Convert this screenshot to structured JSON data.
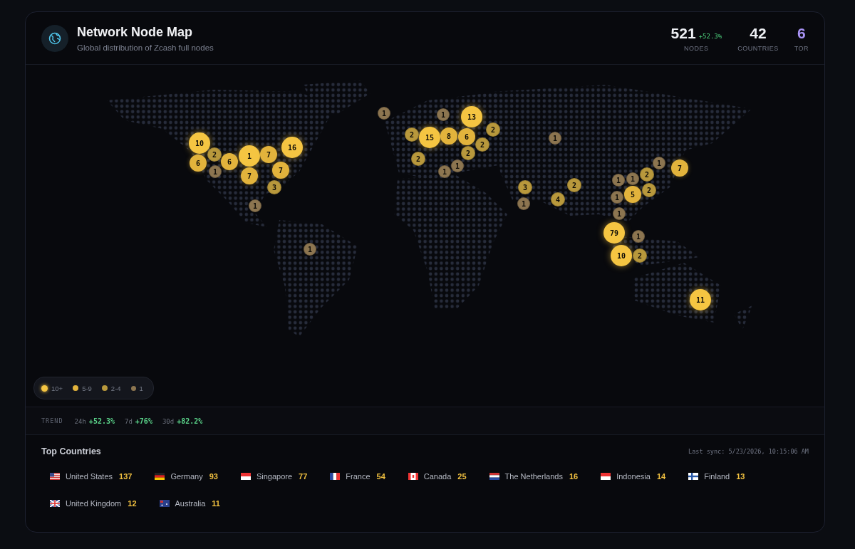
{
  "header": {
    "title": "Network Node Map",
    "subtitle": "Global distribution of Zcash full nodes"
  },
  "stats": [
    {
      "value": "521",
      "change": "+52.3%",
      "label": "NODES",
      "kind": "plain"
    },
    {
      "value": "42",
      "label": "COUNTRIES",
      "kind": "plain"
    },
    {
      "value": "6",
      "label": "TOR",
      "kind": "tor"
    }
  ],
  "map": {
    "bubbles": [
      {
        "count": "10",
        "kind": "large"
      },
      {
        "count": "6",
        "kind": "medium"
      },
      {
        "count": "2",
        "kind": "small"
      },
      {
        "count": "6",
        "kind": "medium"
      },
      {
        "count": "1",
        "kind": "single"
      },
      {
        "count": "1",
        "kind": "large"
      },
      {
        "count": "7",
        "kind": "medium"
      },
      {
        "count": "16",
        "kind": "large"
      },
      {
        "count": "7",
        "kind": "medium"
      },
      {
        "count": "7",
        "kind": "medium"
      },
      {
        "count": "3",
        "kind": "small"
      },
      {
        "count": "1",
        "kind": "single"
      },
      {
        "count": "1",
        "kind": "single"
      },
      {
        "count": "1",
        "kind": "single"
      },
      {
        "count": "1",
        "kind": "single"
      },
      {
        "count": "13",
        "kind": "large"
      },
      {
        "count": "2",
        "kind": "small"
      },
      {
        "count": "15",
        "kind": "large"
      },
      {
        "count": "8",
        "kind": "medium"
      },
      {
        "count": "6",
        "kind": "medium"
      },
      {
        "count": "2",
        "kind": "small"
      },
      {
        "count": "2",
        "kind": "small"
      },
      {
        "count": "2",
        "kind": "small"
      },
      {
        "count": "1",
        "kind": "single"
      },
      {
        "count": "2",
        "kind": "small"
      },
      {
        "count": "1",
        "kind": "single"
      },
      {
        "count": "1",
        "kind": "single"
      },
      {
        "count": "3",
        "kind": "small"
      },
      {
        "count": "1",
        "kind": "single"
      },
      {
        "count": "4",
        "kind": "small"
      },
      {
        "count": "2",
        "kind": "small"
      },
      {
        "count": "1",
        "kind": "single"
      },
      {
        "count": "1",
        "kind": "single"
      },
      {
        "count": "2",
        "kind": "small"
      },
      {
        "count": "1",
        "kind": "single"
      },
      {
        "count": "7",
        "kind": "medium"
      },
      {
        "count": "1",
        "kind": "single"
      },
      {
        "count": "5",
        "kind": "medium"
      },
      {
        "count": "2",
        "kind": "small"
      },
      {
        "count": "1",
        "kind": "single"
      },
      {
        "count": "79",
        "kind": "large"
      },
      {
        "count": "1",
        "kind": "single"
      },
      {
        "count": "10",
        "kind": "large"
      },
      {
        "count": "2",
        "kind": "small"
      },
      {
        "count": "11",
        "kind": "large"
      }
    ],
    "legend": [
      {
        "label": "10+",
        "kind": "large",
        "color": "#f5c542"
      },
      {
        "label": "5-9",
        "kind": "medium",
        "color": "#e2b33c"
      },
      {
        "label": "2-4",
        "kind": "small",
        "color": "#b8983c"
      },
      {
        "label": "1",
        "kind": "single",
        "color": "#8c7550"
      }
    ]
  },
  "trend": {
    "label": "TREND",
    "items": [
      {
        "period": "24h",
        "value": "+52.3%"
      },
      {
        "period": "7d",
        "value": "+76%"
      },
      {
        "period": "30d",
        "value": "+82.2%"
      }
    ]
  },
  "top_countries": {
    "title": "Top Countries",
    "last_sync": "Last sync: 5/23/2026, 10:15:06 AM",
    "items": [
      {
        "name": "United States",
        "count": "137",
        "kind": "us"
      },
      {
        "name": "Germany",
        "count": "93",
        "kind": "de"
      },
      {
        "name": "Singapore",
        "count": "77",
        "kind": "sg"
      },
      {
        "name": "France",
        "count": "54",
        "kind": "fr"
      },
      {
        "name": "Canada",
        "count": "25",
        "kind": "ca"
      },
      {
        "name": "The Netherlands",
        "count": "16",
        "kind": "nl"
      },
      {
        "name": "Indonesia",
        "count": "14",
        "kind": "id"
      },
      {
        "name": "Finland",
        "count": "13",
        "kind": "fi"
      },
      {
        "name": "United Kingdom",
        "count": "12",
        "kind": "gb"
      },
      {
        "name": "Australia",
        "count": "11",
        "kind": "au"
      }
    ]
  }
}
